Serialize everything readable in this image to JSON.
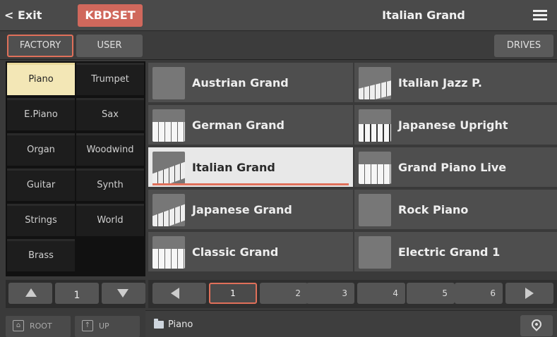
{
  "topbar": {
    "exit_label": "< Exit",
    "kbdset_label": "KBDSET",
    "title": "Italian Grand",
    "menu_icon": "hamburger-menu-icon"
  },
  "tabs": {
    "factory": "FACTORY",
    "user": "USER",
    "drives": "DRIVES"
  },
  "categories": [
    {
      "label": "Piano",
      "active": true
    },
    {
      "label": "Trumpet"
    },
    {
      "label": "E.Piano"
    },
    {
      "label": "Sax"
    },
    {
      "label": "Organ"
    },
    {
      "label": "Woodwind"
    },
    {
      "label": "Guitar"
    },
    {
      "label": "Synth"
    },
    {
      "label": "Strings"
    },
    {
      "label": "World"
    },
    {
      "label": "Brass"
    }
  ],
  "category_pager": {
    "page": "1"
  },
  "nav": {
    "root": "ROOT",
    "up": "UP"
  },
  "sounds": [
    {
      "label": "Austrian Grand",
      "thumb": "wood-grand"
    },
    {
      "label": "Italian Jazz P.",
      "thumb": "dark-keys"
    },
    {
      "label": "German Grand",
      "thumb": "keys"
    },
    {
      "label": "Japanese Upright",
      "thumb": "upright"
    },
    {
      "label": "Italian Grand",
      "thumb": "italian",
      "selected": true
    },
    {
      "label": "Grand Piano Live",
      "thumb": "keys"
    },
    {
      "label": "Japanese Grand",
      "thumb": "italian"
    },
    {
      "label": "Rock Piano",
      "thumb": "grand-bw"
    },
    {
      "label": "Classic Grand",
      "thumb": "keys"
    },
    {
      "label": "Electric Grand 1",
      "thumb": "electric"
    }
  ],
  "pages": [
    "1",
    "2",
    "3",
    "4",
    "5",
    "6"
  ],
  "active_page": "1",
  "path": {
    "folder": "Piano"
  },
  "colors": {
    "accent": "#e0705a",
    "kbdset": "#d0685c",
    "active_category": "#f3e7b6"
  }
}
